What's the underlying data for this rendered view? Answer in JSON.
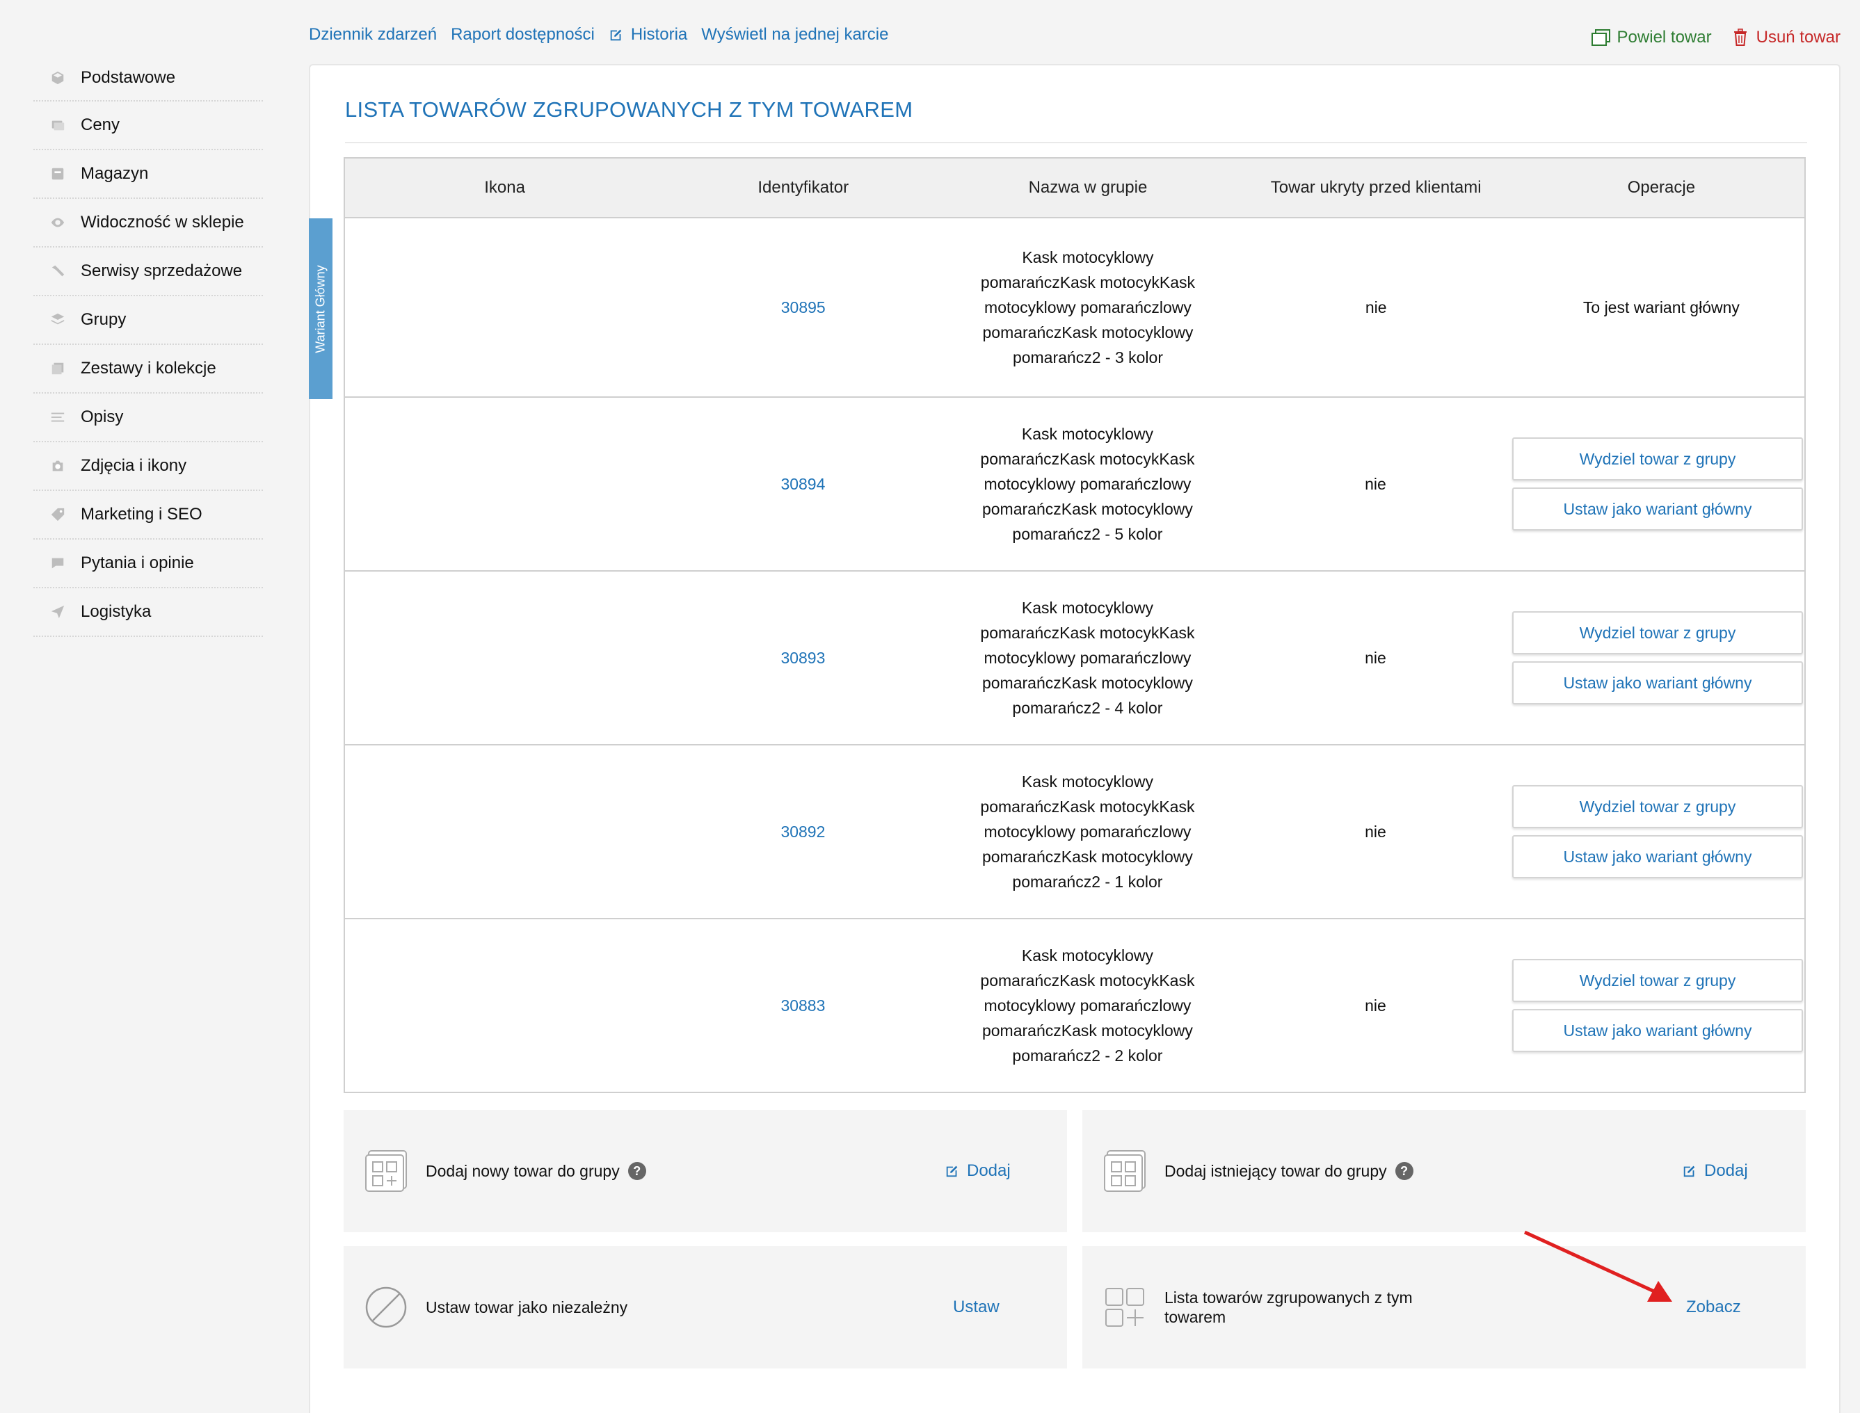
{
  "sidebar": {
    "items": [
      {
        "label": "Podstawowe",
        "icon": "box-icon"
      },
      {
        "label": "Ceny",
        "icon": "price-icon"
      },
      {
        "label": "Magazyn",
        "icon": "warehouse-icon"
      },
      {
        "label": "Widoczność w sklepie",
        "icon": "eye-icon"
      },
      {
        "label": "Serwisy sprzedażowe",
        "icon": "hammer-icon"
      },
      {
        "label": "Grupy",
        "icon": "layers-icon"
      },
      {
        "label": "Zestawy i kolekcje",
        "icon": "collection-icon"
      },
      {
        "label": "Opisy",
        "icon": "text-icon"
      },
      {
        "label": "Zdjęcia i ikony",
        "icon": "camera-icon"
      },
      {
        "label": "Marketing i SEO",
        "icon": "tag-icon"
      },
      {
        "label": "Pytania i opinie",
        "icon": "comment-icon"
      },
      {
        "label": "Logistyka",
        "icon": "plane-icon"
      }
    ]
  },
  "topnav": {
    "events": "Dziennik zdarzeń",
    "availability": "Raport dostępności",
    "history": "Historia",
    "single_card": "Wyświetl na jednej karcie",
    "duplicate": "Powiel towar",
    "delete": "Usuń towar"
  },
  "panel": {
    "title": "LISTA TOWARÓW ZGRUPOWANYCH Z TYM TOWAREM",
    "ribbon": "Wariant Główny"
  },
  "table": {
    "headers": [
      "Ikona",
      "Identyfikator",
      "Nazwa w grupie",
      "Towar ukryty przed klientami",
      "Operacje"
    ],
    "main_variant_text": "To jest wariant główny",
    "btn_extract": "Wydziel towar z grupy",
    "btn_set_main": "Ustaw jako wariant główny",
    "rows": [
      {
        "id": "30895",
        "name": [
          "Kask motocyklowy",
          "pomarańczKask motocykKask",
          "motocyklowy pomarańczlowy",
          "pomarańczKask motocyklowy",
          "pomarańcz2 - 3 kolor"
        ],
        "hidden": "nie",
        "main": true
      },
      {
        "id": "30894",
        "name": [
          "Kask motocyklowy",
          "pomarańczKask motocykKask",
          "motocyklowy pomarańczlowy",
          "pomarańczKask motocyklowy",
          "pomarańcz2 - 5 kolor"
        ],
        "hidden": "nie",
        "main": false
      },
      {
        "id": "30893",
        "name": [
          "Kask motocyklowy",
          "pomarańczKask motocykKask",
          "motocyklowy pomarańczlowy",
          "pomarańczKask motocyklowy",
          "pomarańcz2 - 4 kolor"
        ],
        "hidden": "nie",
        "main": false
      },
      {
        "id": "30892",
        "name": [
          "Kask motocyklowy",
          "pomarańczKask motocykKask",
          "motocyklowy pomarańczlowy",
          "pomarańczKask motocyklowy",
          "pomarańcz2 - 1 kolor"
        ],
        "hidden": "nie",
        "main": false
      },
      {
        "id": "30883",
        "name": [
          "Kask motocyklowy",
          "pomarańczKask motocykKask",
          "motocyklowy pomarańczlowy",
          "pomarańczKask motocyklowy",
          "pomarańcz2 - 2 kolor"
        ],
        "hidden": "nie",
        "main": false
      }
    ]
  },
  "actions": {
    "add_new": {
      "label": "Dodaj nowy towar do grupy",
      "button": "Dodaj"
    },
    "add_existing": {
      "label": "Dodaj istniejący towar do grupy",
      "button": "Dodaj"
    },
    "set_independent": {
      "label": "Ustaw towar jako niezależny",
      "button": "Ustaw"
    },
    "grouped_list": {
      "label_line1": "Lista towarów zgrupowanych z tym",
      "label_line2": "towarem",
      "button": "Zobacz"
    }
  },
  "colors": {
    "accent": "#1f73b7",
    "ribbon": "#5b9fd0",
    "duplicate": "#2e7d32",
    "delete": "#c62828",
    "arrow": "#e02020"
  }
}
